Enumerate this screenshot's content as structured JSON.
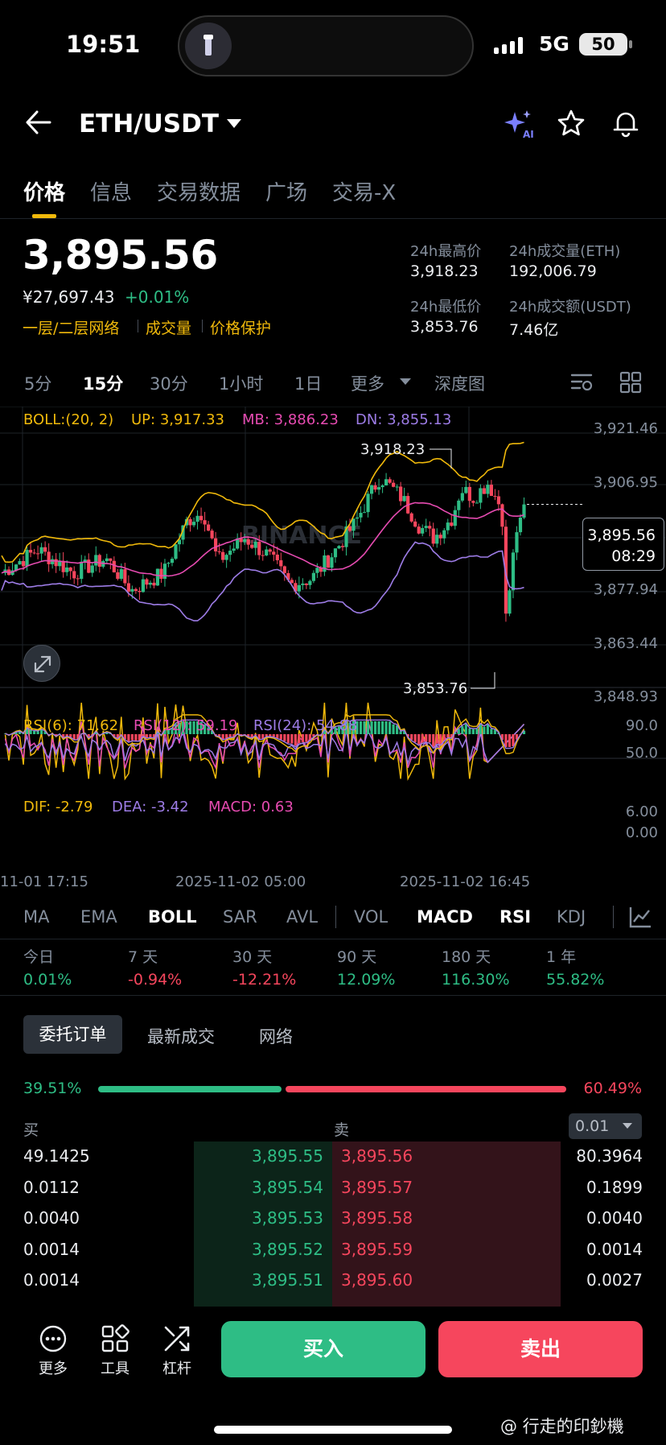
{
  "status": {
    "time": "19:51",
    "network": "5G",
    "battery": "50"
  },
  "header": {
    "pair": "ETH/USDT",
    "icons": [
      "back-arrow-icon",
      "ai-sparkle-icon",
      "star-icon",
      "bell-icon"
    ]
  },
  "tabs": [
    "价格",
    "信息",
    "交易数据",
    "广场",
    "交易-X"
  ],
  "ticker": {
    "price": "3,895.56",
    "cny": "¥27,697.43",
    "change": "+0.01%",
    "links": [
      "一层/二层网络",
      "成交量",
      "价格保护"
    ],
    "stats": [
      {
        "label": "24h最高价",
        "value": "3,918.23"
      },
      {
        "label": "24h成交量(ETH)",
        "value": "192,006.79"
      },
      {
        "label": "24h最低价",
        "value": "3,853.76"
      },
      {
        "label": "24h成交额(USDT)",
        "value": "7.46亿"
      }
    ]
  },
  "intervals": [
    "5分",
    "15分",
    "30分",
    "1小时",
    "1日",
    "更多",
    "深度图"
  ],
  "chart": {
    "boll": {
      "label": "BOLL:(20, 2)",
      "up": "UP: 3,917.33",
      "mb": "MB: 3,886.23",
      "dn": "DN: 3,855.13"
    },
    "price_axis": [
      "3,921.46",
      "3,906.95",
      "3,877.94",
      "3,863.44",
      "3,848.93"
    ],
    "high_label": "3,918.23",
    "low_label": "3,853.76",
    "current": {
      "price": "3,895.56",
      "countdown": "08:29"
    },
    "watermark": "BINANCE",
    "rsi": {
      "r6": "RSI(6): 71.62",
      "r12": "RSI(12): 59.19",
      "r24": "RSI(24): 54.88",
      "axis": [
        "90.0",
        "50.0"
      ]
    },
    "macd": {
      "dif": "DIF: -2.79",
      "dea": "DEA: -3.42",
      "macd": "MACD: 0.63",
      "axis": [
        "6.00",
        "0.00"
      ]
    },
    "time_axis": [
      "11-01 17:15",
      "2025-11-02 05:00",
      "2025-11-02 16:45"
    ],
    "colors": {
      "up": "#2ebd85",
      "down": "#f6465d",
      "boll_up": "#f0b90b",
      "boll_mb": "#e64bb1",
      "boll_dn": "#9d7ce6"
    }
  },
  "indicators": [
    "MA",
    "EMA",
    "BOLL",
    "SAR",
    "AVL",
    "VOL",
    "MACD",
    "RSI",
    "KDJ"
  ],
  "indicators_active": [
    "BOLL",
    "MACD",
    "RSI"
  ],
  "periods": [
    {
      "label": "今日",
      "value": "0.01%"
    },
    {
      "label": "7 天",
      "value": "-0.94%"
    },
    {
      "label": "30 天",
      "value": "-12.21%"
    },
    {
      "label": "90 天",
      "value": "12.09%"
    },
    {
      "label": "180 天",
      "value": "116.30%"
    },
    {
      "label": "1 年",
      "value": "55.82%"
    }
  ],
  "orderbook": {
    "tabs": [
      "委托订单",
      "最新成交",
      "网络"
    ],
    "buy_ratio": "39.51%",
    "sell_ratio": "60.49%",
    "buy_label": "买",
    "sell_label": "卖",
    "precision": "0.01",
    "rows": [
      {
        "bid_qty": "49.1425",
        "bid": "3,895.55",
        "ask": "3,895.56",
        "ask_qty": "80.3964"
      },
      {
        "bid_qty": "0.0112",
        "bid": "3,895.54",
        "ask": "3,895.57",
        "ask_qty": "0.1899"
      },
      {
        "bid_qty": "0.0040",
        "bid": "3,895.53",
        "ask": "3,895.58",
        "ask_qty": "0.0040"
      },
      {
        "bid_qty": "0.0014",
        "bid": "3,895.52",
        "ask": "3,895.59",
        "ask_qty": "0.0014"
      },
      {
        "bid_qty": "0.0014",
        "bid": "3,895.51",
        "ask": "3,895.60",
        "ask_qty": "0.0027"
      }
    ]
  },
  "bottom": {
    "more": "更多",
    "tools": "工具",
    "leverage": "杠杆",
    "buy": "买入",
    "sell": "卖出"
  },
  "watermark_text": "@ 行走的印鈔機"
}
